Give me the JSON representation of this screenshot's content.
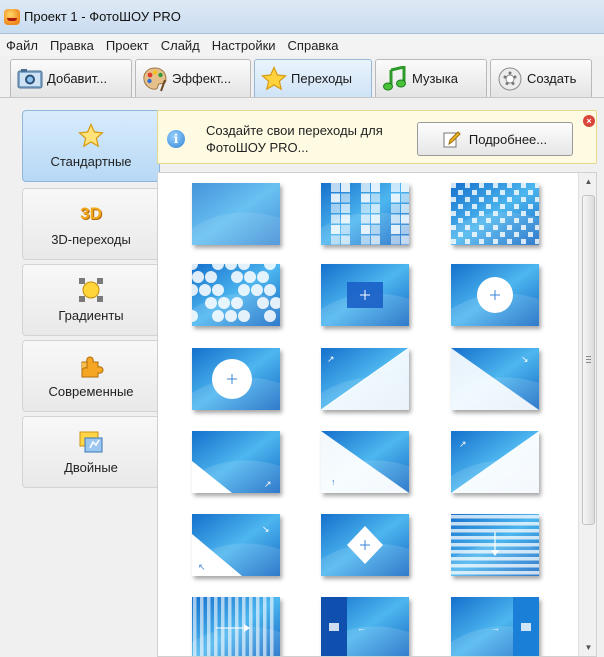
{
  "window": {
    "title": "Проект 1 - ФотоШОУ PRO"
  },
  "menu": [
    "Файл",
    "Правка",
    "Проект",
    "Слайд",
    "Настройки",
    "Справка"
  ],
  "tabs": [
    {
      "label": "Добавит...",
      "icon": "photos-icon"
    },
    {
      "label": "Эффект...",
      "icon": "palette-icon"
    },
    {
      "label": "Переходы",
      "icon": "star-icon",
      "active": true
    },
    {
      "label": "Музыка",
      "icon": "music-icon"
    },
    {
      "label": "Создать",
      "icon": "disc-icon"
    }
  ],
  "sidebar": {
    "items": [
      {
        "label": "Стандартные",
        "icon": "star-icon",
        "active": true
      },
      {
        "label": "3D-переходы",
        "icon": "3d-icon",
        "icon_text": "3D"
      },
      {
        "label": "Градиенты",
        "icon": "gradient-icon"
      },
      {
        "label": "Современные",
        "icon": "puzzle-icon"
      },
      {
        "label": "Двойные",
        "icon": "double-icon"
      }
    ]
  },
  "info": {
    "text": "Создайте свои переходы для ФотоШОУ PRO...",
    "button_label": "Подробнее...",
    "close_glyph": "×"
  },
  "gallery": {
    "columns": 3,
    "items": [
      {
        "name": "fade",
        "pattern": "plain"
      },
      {
        "name": "squares",
        "pattern": "squares"
      },
      {
        "name": "dots",
        "pattern": "dots"
      },
      {
        "name": "hexagons",
        "pattern": "hex"
      },
      {
        "name": "rect-zoom",
        "pattern": "rect-center"
      },
      {
        "name": "circle-zoom",
        "pattern": "circle-center"
      },
      {
        "name": "circle-expand",
        "pattern": "circle-big"
      },
      {
        "name": "wipe-diagonal-tl",
        "pattern": "diag-tl"
      },
      {
        "name": "wipe-diagonal-tr",
        "pattern": "diag-tr"
      },
      {
        "name": "wipe-diagonal-bl",
        "pattern": "diag-bl"
      },
      {
        "name": "wipe-diagonal-br",
        "pattern": "diag-br"
      },
      {
        "name": "wipe-diagonal-tr2",
        "pattern": "diag-tr2"
      },
      {
        "name": "wipe-corner-bl",
        "pattern": "diag-bl2"
      },
      {
        "name": "diamond",
        "pattern": "diamond"
      },
      {
        "name": "blinds-horizontal",
        "pattern": "hstripes"
      },
      {
        "name": "blinds-vertical",
        "pattern": "vstripes"
      },
      {
        "name": "split-right",
        "pattern": "split-r"
      },
      {
        "name": "split-left",
        "pattern": "split-l"
      }
    ]
  },
  "colors": {
    "accent": "#1b7fd6",
    "info_bg": "#fffbe3",
    "active_tab": "#cfe3f7"
  }
}
